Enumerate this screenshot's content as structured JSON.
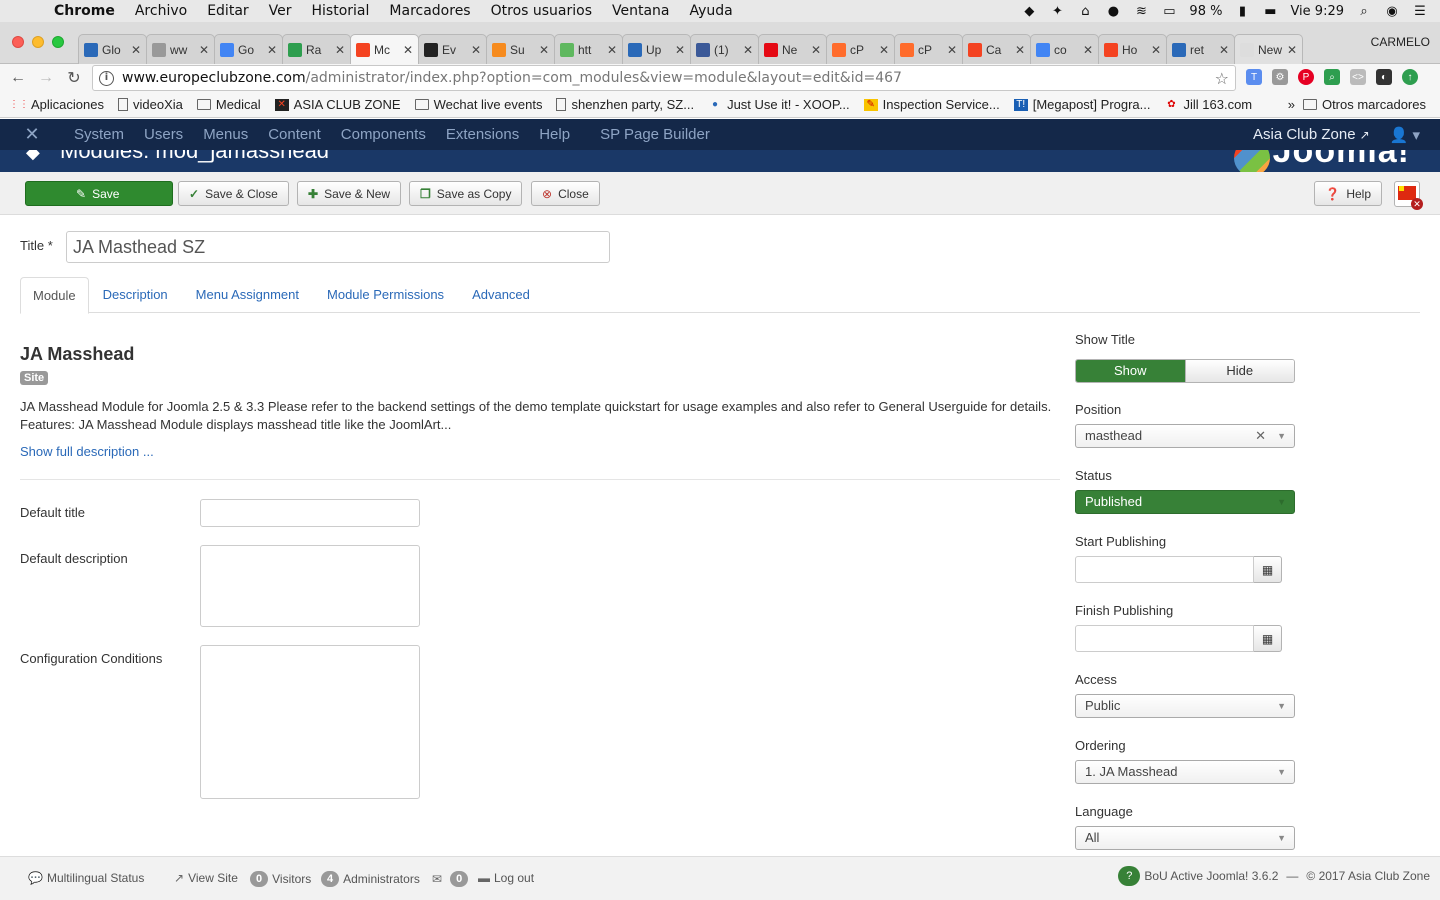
{
  "macos": {
    "menus": [
      "Chrome",
      "Archivo",
      "Editar",
      "Ver",
      "Historial",
      "Marcadores",
      "Otros usuarios",
      "Ventana",
      "Ayuda"
    ],
    "battery": "98 %",
    "clock": "Vie 9:29"
  },
  "browser": {
    "tabs": [
      {
        "label": "Glo",
        "fav_color": "#2a69b8"
      },
      {
        "label": "ww",
        "fav_color": "#999999"
      },
      {
        "label": "Go",
        "fav_color": "#4285f4"
      },
      {
        "label": "Ra",
        "fav_color": "#2e9e4f"
      },
      {
        "label": "Mc",
        "fav_color": "#f44321",
        "active": true
      },
      {
        "label": "Ev",
        "fav_color": "#222222"
      },
      {
        "label": "Su",
        "fav_color": "#f68b1e"
      },
      {
        "label": "htt",
        "fav_color": "#5fb85f"
      },
      {
        "label": "Up",
        "fav_color": "#2a69b8"
      },
      {
        "label": "(1)",
        "fav_color": "#3b5998"
      },
      {
        "label": "Ne",
        "fav_color": "#e50914"
      },
      {
        "label": "cP",
        "fav_color": "#ff6c2c"
      },
      {
        "label": "cP",
        "fav_color": "#ff6c2c"
      },
      {
        "label": "Ca",
        "fav_color": "#f44321"
      },
      {
        "label": "co",
        "fav_color": "#4285f4"
      },
      {
        "label": "Ho",
        "fav_color": "#f44321"
      },
      {
        "label": "ret",
        "fav_color": "#2a69b8"
      },
      {
        "label": "New T",
        "fav_color": "#dddddd"
      }
    ],
    "profile": "CARMELO",
    "url_host": "www.europeclubzone.com",
    "url_path": "/administrator/index.php?option=com_modules&view=module&layout=edit&id=467",
    "bookmarks": [
      "Aplicaciones",
      "videoXia",
      "Medical",
      "ASIA CLUB ZONE",
      "Wechat live events",
      "shenzhen party, SZ...",
      "Just Use it! - XOOP...",
      "Inspection Service...",
      "[Megapost] Progra...",
      "Jill 163.com"
    ],
    "bookmarks_more": "»",
    "other_bookmarks": "Otros marcadores"
  },
  "joomla": {
    "nav": [
      "System",
      "Users",
      "Menus",
      "Content",
      "Components",
      "Extensions",
      "Help"
    ],
    "nav_extra": "SP Page Builder",
    "site_name": "Asia Club Zone",
    "page_title": "Modules: mod_jamasshead",
    "brand": "Joomla!"
  },
  "toolbar": {
    "save": "Save",
    "save_close": "Save & Close",
    "save_new": "Save & New",
    "save_copy": "Save as Copy",
    "close": "Close",
    "help": "Help"
  },
  "form": {
    "title_label": "Title *",
    "title_value": "JA Masthead SZ",
    "tabs": [
      "Module",
      "Description",
      "Menu Assignment",
      "Module Permissions",
      "Advanced"
    ],
    "module_name": "JA Masshead",
    "badge": "Site",
    "description": "JA Masshead Module for Joomla 2.5 & 3.3 Please refer to the backend settings of the demo template quickstart for usage examples and also refer to General Userguide for details. Features: JA Masshead Module displays masshead title like the JoomlArt...",
    "show_full": "Show full description ...",
    "default_title_label": "Default title",
    "default_description_label": "Default description",
    "config_conditions_label": "Configuration Conditions"
  },
  "sidebar": {
    "show_title_label": "Show Title",
    "show": "Show",
    "hide": "Hide",
    "position_label": "Position",
    "position_value": "masthead",
    "status_label": "Status",
    "status_value": "Published",
    "start_label": "Start Publishing",
    "finish_label": "Finish Publishing",
    "access_label": "Access",
    "access_value": "Public",
    "ordering_label": "Ordering",
    "ordering_value": "1. JA Masshead",
    "language_label": "Language",
    "language_value": "All"
  },
  "status": {
    "multilingual": "Multilingual Status",
    "view_site": "View Site",
    "visitors_count": "0",
    "visitors": "Visitors",
    "admins_count": "4",
    "admins": "Administrators",
    "messages_count": "0",
    "logout": "Log out",
    "version": "BoU Active Joomla! 3.6.2",
    "separator": "—",
    "copyright": "© 2017 Asia Club Zone"
  },
  "colors": {
    "joomla_nav": "#142849",
    "save_green": "#2f8a2f",
    "link_blue": "#2a69b8"
  }
}
